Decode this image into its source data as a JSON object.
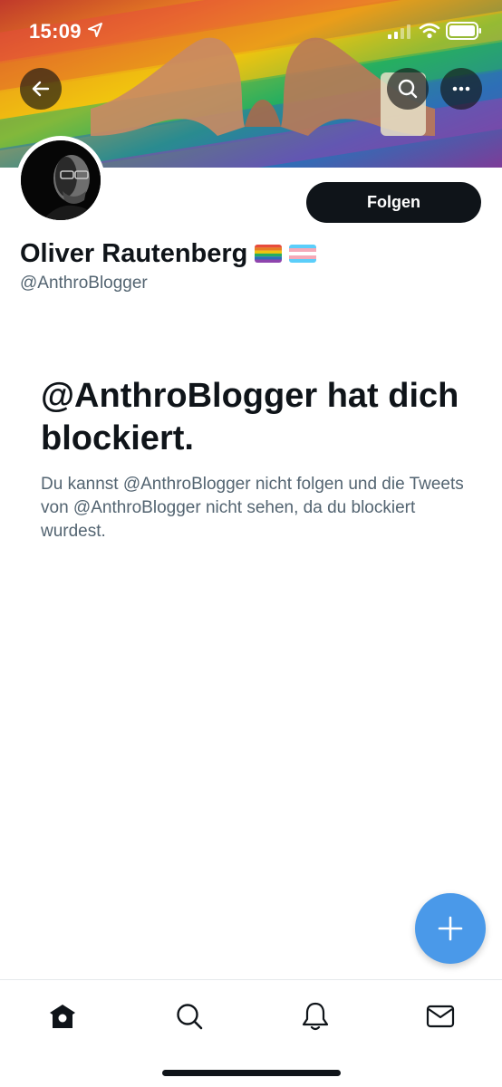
{
  "status_bar": {
    "time": "15:09",
    "icons": [
      "location-arrow-icon",
      "cellular-signal-icon",
      "wifi-icon",
      "battery-icon"
    ]
  },
  "header": {
    "banner_colors": [
      "#e74c3c",
      "#e67e22",
      "#f1c40f",
      "#27ae60",
      "#2e6fb7",
      "#8e44ad"
    ],
    "buttons": [
      "back-arrow-icon",
      "search-icon",
      "more-icon"
    ]
  },
  "profile": {
    "display_name": "Oliver Rautenberg",
    "handle": "@AnthroBlogger",
    "follow_label": "Folgen",
    "emoji_flags": [
      "rainbow-flag-icon",
      "transgender-flag-icon"
    ]
  },
  "blocked": {
    "title": "@AnthroBlogger hat dich blockiert.",
    "description": "Du kannst @AnthroBlogger nicht folgen und die Tweets von @AnthroBlogger nicht sehen, da du blockiert wurdest."
  },
  "fab": {
    "icon": "plus-icon"
  },
  "tab_bar": {
    "items": [
      "home-icon",
      "search-icon",
      "bell-icon",
      "envelope-icon"
    ],
    "active": "home"
  },
  "colors": {
    "accent": "#4a99e9",
    "text_primary": "#0f1419",
    "text_secondary": "#536471"
  }
}
